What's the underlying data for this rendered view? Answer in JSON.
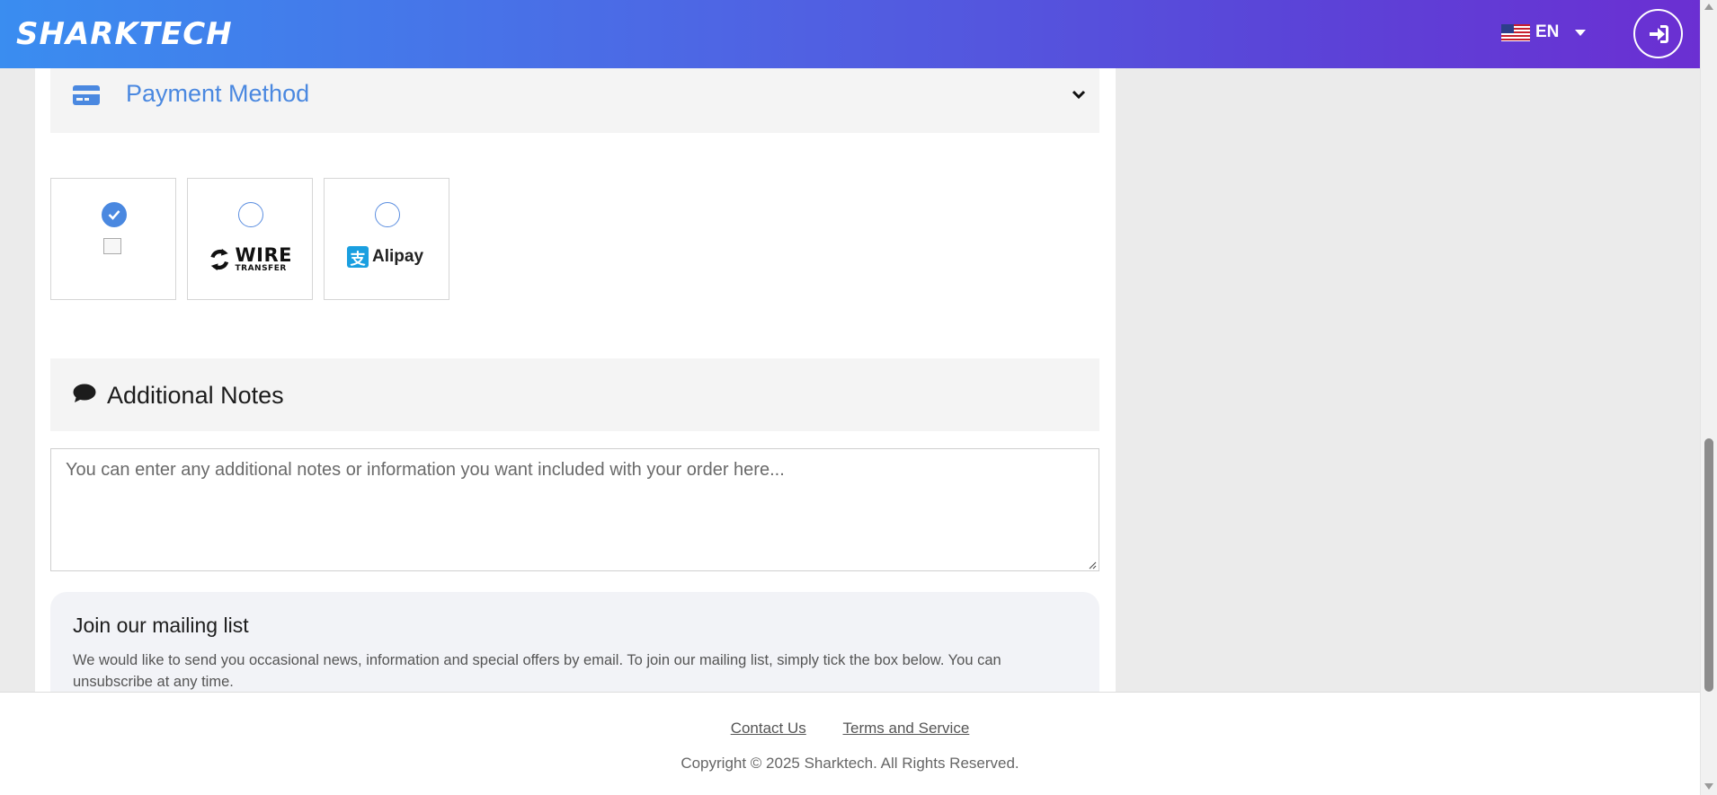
{
  "header": {
    "logo": "SHARKTECH",
    "language": "EN",
    "flag_icon": "us-flag-icon",
    "login_icon": "sign-in-icon",
    "gradient_start": "#3a8df0",
    "gradient_end": "#6b2fd2"
  },
  "payment": {
    "title": "Payment Method",
    "icon": "credit-card-icon",
    "options": [
      {
        "name": "broken image option",
        "selected": true
      },
      {
        "name": "WIRE",
        "sub": "TRANSFER",
        "selected": false
      },
      {
        "name": "Alipay",
        "glyph": "支",
        "selected": false
      }
    ],
    "accent": "#4a88e0"
  },
  "notes": {
    "title": "Additional Notes",
    "icon": "comment-icon",
    "placeholder": "You can enter any additional notes or information you want included with your order here..."
  },
  "mailing": {
    "title": "Join our mailing list",
    "text": "We would like to send you occasional news, information and special offers by email. To join our mailing list, simply tick the box below. You can unsubscribe at any time."
  },
  "footer": {
    "contact": "Contact Us",
    "terms": "Terms and Service",
    "copyright": "Copyright © 2025 Sharktech. All Rights Reserved."
  }
}
